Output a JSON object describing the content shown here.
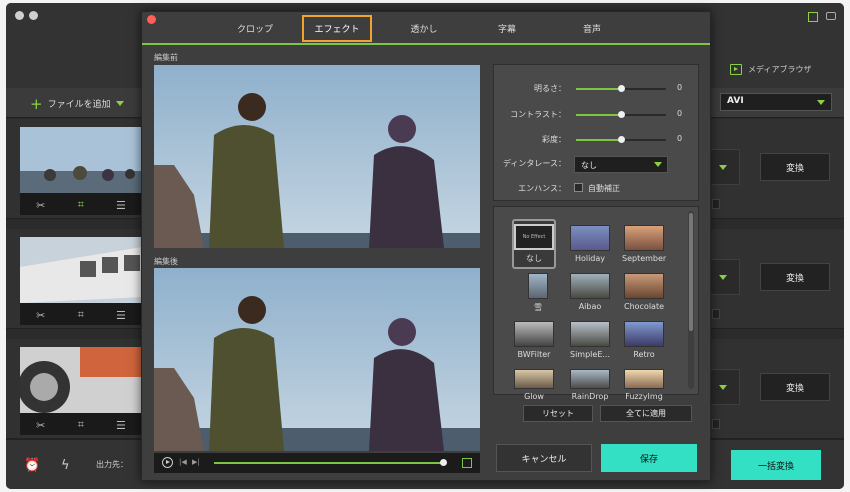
{
  "main": {
    "add_files_label": "ファイルを追加",
    "media_browser_label": "メディアブラウザ",
    "format_value": "AVI",
    "convert_label": "変換",
    "output_label": "出力先：",
    "convert_all_label": "一括変換"
  },
  "modal": {
    "tabs": [
      {
        "label": "クロップ"
      },
      {
        "label": "エフェクト"
      },
      {
        "label": "透かし"
      },
      {
        "label": "字幕"
      },
      {
        "label": "音声"
      }
    ],
    "active_tab": "エフェクト",
    "before_label": "編集前",
    "after_label": "編集後",
    "settings": {
      "brightness_label": "明るさ：",
      "brightness_value": "0",
      "contrast_label": "コントラスト：",
      "contrast_value": "0",
      "saturation_label": "彩度：",
      "saturation_value": "0",
      "slider_level": 0.5,
      "deinterlace_label": "ディンタレース：",
      "deinterlace_value": "なし",
      "enhance_label": "エンハンス：",
      "auto_correct_label": "自動補正"
    },
    "effects": [
      {
        "name": "なし",
        "thumb_text": "No Effect"
      },
      {
        "name": "Holiday"
      },
      {
        "name": "September"
      },
      {
        "name": "雪"
      },
      {
        "name": "Aibao"
      },
      {
        "name": "Chocolate"
      },
      {
        "name": "BWFilter"
      },
      {
        "name": "SimpleE..."
      },
      {
        "name": "Retro"
      },
      {
        "name": "Glow"
      },
      {
        "name": "RainDrop"
      },
      {
        "name": "FuzzyImg"
      }
    ],
    "reset_label": "リセット",
    "apply_all_label": "全てに適用",
    "cancel_label": "キャンセル",
    "save_label": "保存",
    "playback_progress": 0.97
  },
  "colors": {
    "accent_green": "#7dc645",
    "active_tab_border": "#f0a42a",
    "teal_button": "#34e0c4"
  }
}
